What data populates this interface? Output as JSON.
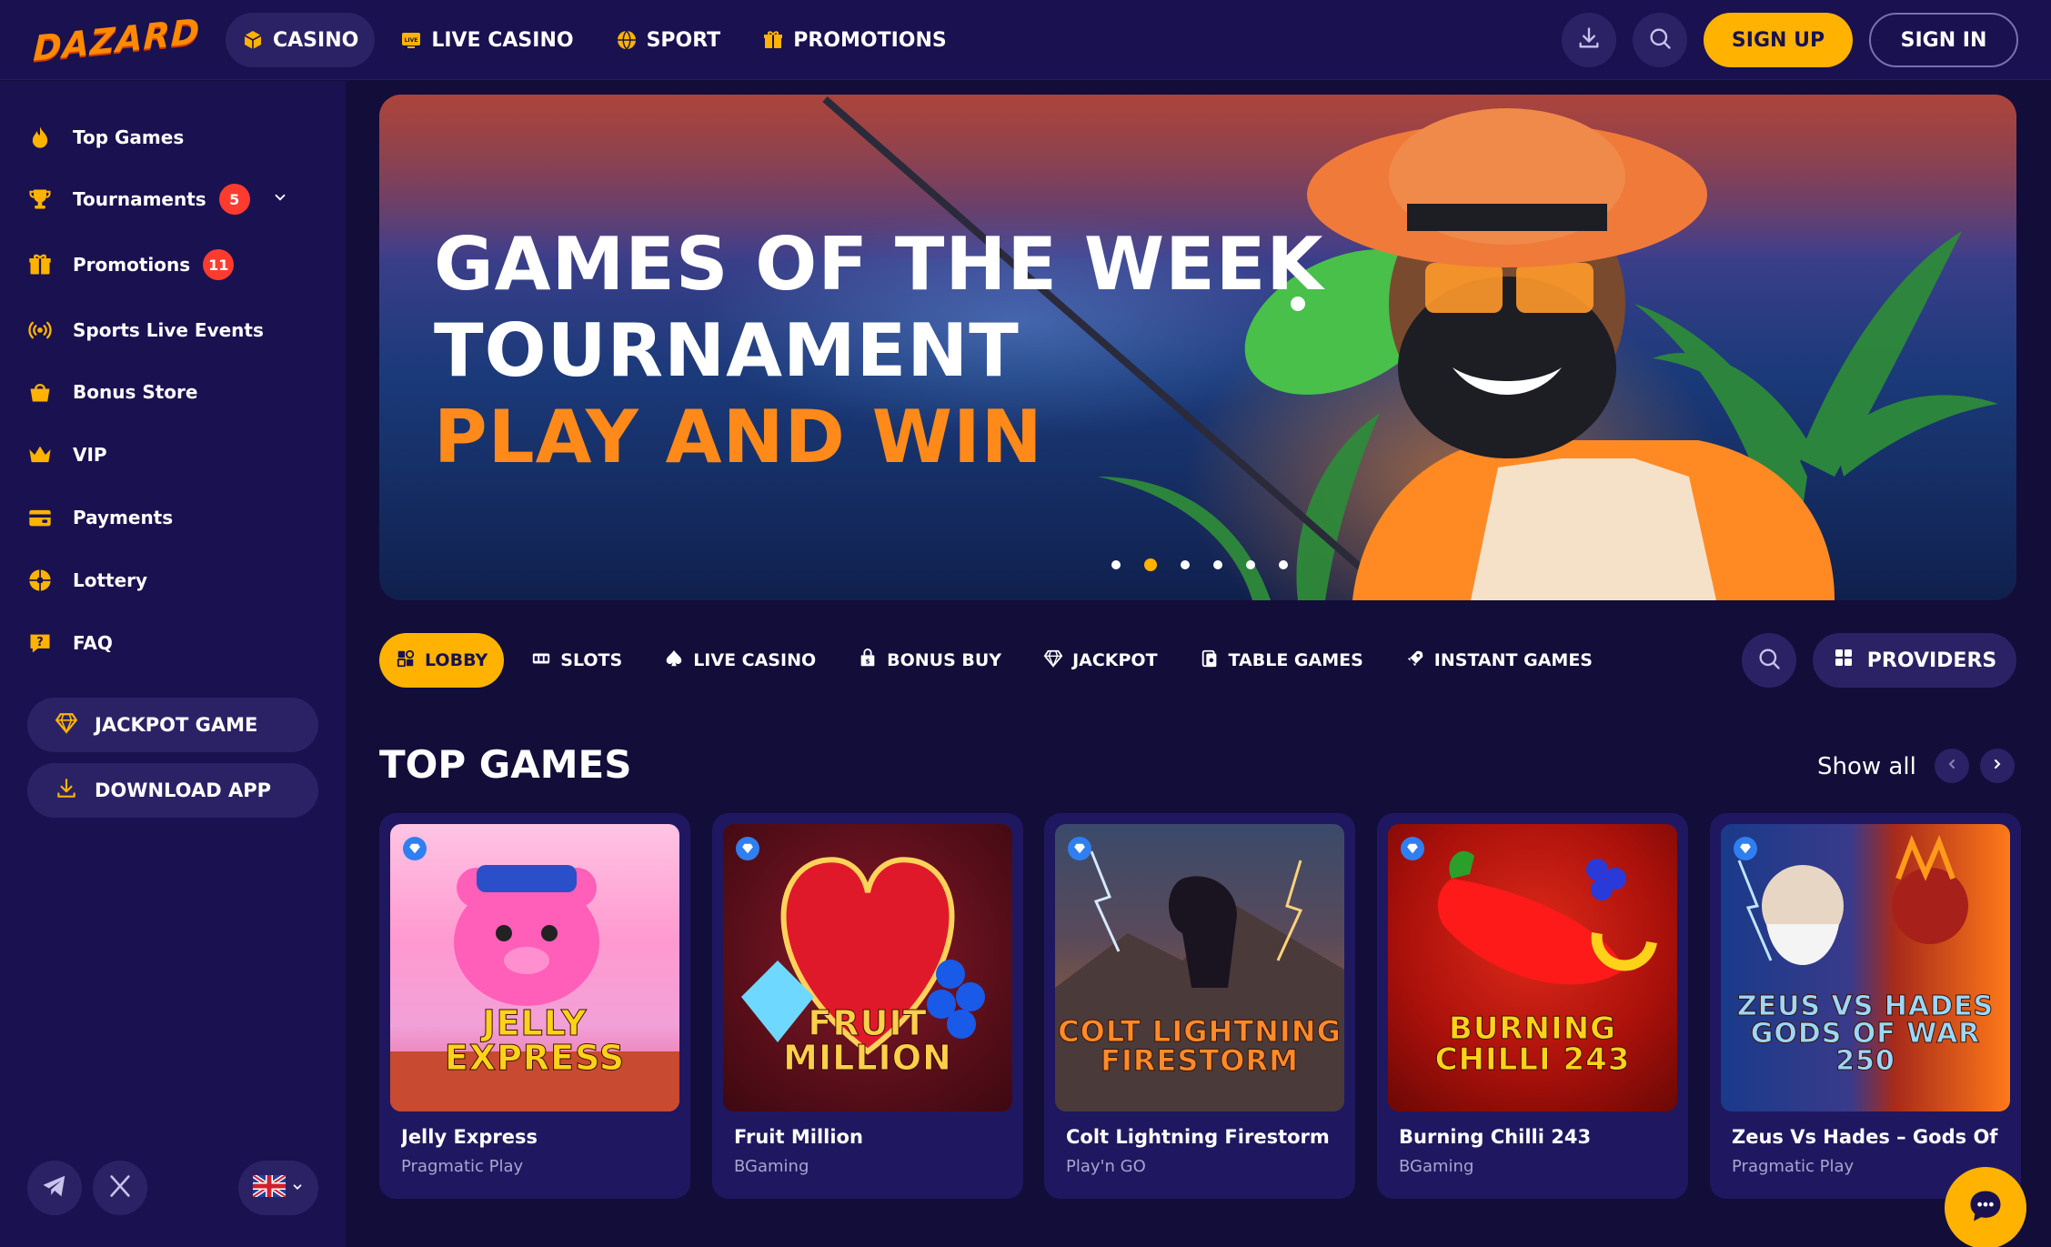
{
  "header": {
    "logo": "DAZARD",
    "nav": [
      {
        "label": "CASINO",
        "icon": "cube-icon",
        "active": true
      },
      {
        "label": "LIVE CASINO",
        "icon": "live-tv-icon",
        "active": false
      },
      {
        "label": "SPORT",
        "icon": "ball-icon",
        "active": false
      },
      {
        "label": "PROMOTIONS",
        "icon": "gift-icon",
        "active": false
      }
    ],
    "download_icon": "download-icon",
    "search_icon": "search-icon",
    "signup_label": "SIGN UP",
    "signin_label": "SIGN IN"
  },
  "sidebar": {
    "items": [
      {
        "label": "Top Games",
        "icon": "fire-icon"
      },
      {
        "label": "Tournaments",
        "icon": "trophy-icon",
        "badge": "5"
      },
      {
        "label": "Promotions",
        "icon": "gift-icon",
        "badge": "11"
      },
      {
        "label": "Sports Live Events",
        "icon": "broadcast-icon"
      },
      {
        "label": "Bonus Store",
        "icon": "basket-icon"
      },
      {
        "label": "VIP",
        "icon": "crown-icon"
      },
      {
        "label": "Payments",
        "icon": "wallet-icon"
      },
      {
        "label": "Lottery",
        "icon": "lottery-ball-icon"
      },
      {
        "label": "FAQ",
        "icon": "question-icon"
      }
    ],
    "jackpot_label": "JACKPOT GAME",
    "download_label": "DOWNLOAD APP"
  },
  "banner": {
    "line1": "GAMES OF THE WEEK",
    "line2": "TOURNAMENT",
    "line3": "PLAY AND WIN",
    "slide_count": 6,
    "active_slide": 2
  },
  "categories": [
    {
      "label": "LOBBY",
      "icon": "lobby-icon",
      "active": true
    },
    {
      "label": "SLOTS",
      "icon": "slots-icon",
      "active": false
    },
    {
      "label": "LIVE CASINO",
      "icon": "spade-icon",
      "active": false
    },
    {
      "label": "BONUS BUY",
      "icon": "bonus-icon",
      "active": false
    },
    {
      "label": "JACKPOT",
      "icon": "diamond-icon",
      "active": false
    },
    {
      "label": "TABLE GAMES",
      "icon": "cards-icon",
      "active": false
    },
    {
      "label": "INSTANT GAMES",
      "icon": "rocket-icon",
      "active": false
    }
  ],
  "providers_label": "PROVIDERS",
  "top_games": {
    "title": "TOP GAMES",
    "show_all": "Show all",
    "games": [
      {
        "name": "Jelly Express",
        "provider": "Pragmatic Play",
        "thumb_title": "JELLY EXPRESS"
      },
      {
        "name": "Fruit Million",
        "provider": "BGaming",
        "thumb_title": "FRUIT MILLION"
      },
      {
        "name": "Colt Lightning Firestorm",
        "provider": "Play'n GO",
        "thumb_title": "COLT LIGHTNING FIRESTORM"
      },
      {
        "name": "Burning Chilli 243",
        "provider": "BGaming",
        "thumb_title": "BURNING CHILLI 243"
      },
      {
        "name": "Zeus Vs Hades – Gods Of Wa...",
        "provider": "Pragmatic Play",
        "thumb_title": "ZEUS VS HADES GODS OF WAR 250"
      }
    ]
  },
  "colors": {
    "bg": "#130d3a",
    "panel": "#1a1150",
    "accent": "#ffb300",
    "badge": "#ff3b30"
  }
}
